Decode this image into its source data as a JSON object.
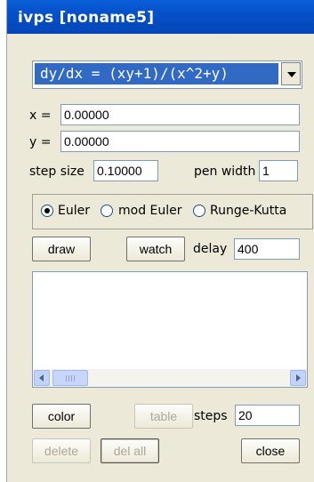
{
  "window": {
    "title": "ivps  [noname5]"
  },
  "equation": {
    "selected": "dy/dx = (xy+1)/(x^2+y)"
  },
  "fields": {
    "x_label": "x =",
    "x_value": "0.00000",
    "y_label": "y =",
    "y_value": "0.00000",
    "step_label": "step size",
    "step_value": "0.10000",
    "pen_label": "pen width",
    "pen_value": "1"
  },
  "methods": [
    {
      "label": "Euler",
      "selected": true
    },
    {
      "label": "mod Euler",
      "selected": false
    },
    {
      "label": "Runge-Kutta",
      "selected": false
    }
  ],
  "actions": {
    "draw": "draw",
    "watch": "watch",
    "delay_label": "delay",
    "delay_value": "400",
    "color": "color",
    "table": "table",
    "steps_label": "steps",
    "steps_value": "20",
    "delete": "delete",
    "del_all": "del all",
    "close": "close"
  },
  "colors": {
    "title_bar": "#0550c8",
    "selection": "#316ac5",
    "window_bg": "#ece9d8"
  }
}
